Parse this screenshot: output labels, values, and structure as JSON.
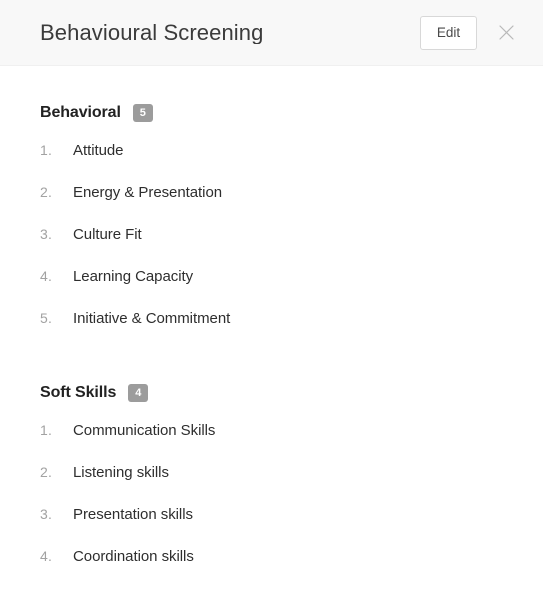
{
  "header": {
    "title": "Behavioural Screening",
    "edit_label": "Edit",
    "close_icon": "close-icon"
  },
  "sections": [
    {
      "name": "Behavioral",
      "count": "5",
      "items": [
        {
          "index": "1.",
          "label": "Attitude"
        },
        {
          "index": "2.",
          "label": "Energy & Presentation"
        },
        {
          "index": "3.",
          "label": "Culture Fit"
        },
        {
          "index": "4.",
          "label": "Learning Capacity"
        },
        {
          "index": "5.",
          "label": "Initiative & Commitment"
        }
      ]
    },
    {
      "name": "Soft Skills",
      "count": "4",
      "items": [
        {
          "index": "1.",
          "label": "Communication Skills"
        },
        {
          "index": "2.",
          "label": "Listening skills"
        },
        {
          "index": "3.",
          "label": "Presentation skills"
        },
        {
          "index": "4.",
          "label": "Coordination skills"
        }
      ]
    }
  ],
  "colors": {
    "header_background": "#f8f8f8",
    "body_background": "#ffffff",
    "title_text": "#3b3b3b",
    "badge_background": "#9c9c9c",
    "badge_text": "#ffffff",
    "index_text": "#a2a2a2",
    "item_text": "#2e2e2e",
    "button_border": "#d8d8d8",
    "close_icon": "#b9b9b9"
  }
}
